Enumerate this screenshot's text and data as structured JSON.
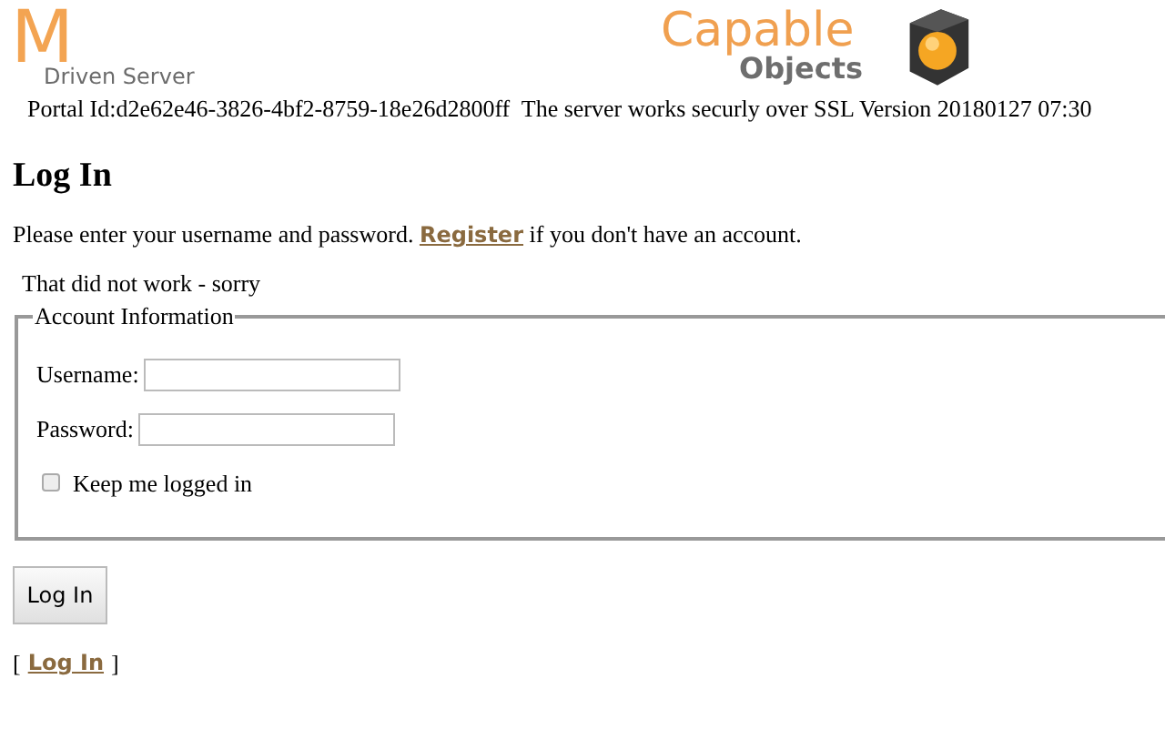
{
  "header": {
    "logo_letter": "M",
    "logo_subtitle": "Driven Server",
    "brand_top": "Capable",
    "brand_bottom": "Objects",
    "status": "Portal Id:d2e62e46-3826-4bf2-8759-18e26d2800ff  The server works securly over SSL Version 20180127 07:30"
  },
  "heading": "Log In",
  "intro": {
    "before": "Please enter your username and password.",
    "link": "Register",
    "after": "if you don't have an account."
  },
  "error": "That did not work - sorry",
  "fieldset": {
    "legend": "Account Information",
    "fields": [
      {
        "label": "Username:"
      },
      {
        "label": "Password:"
      }
    ],
    "remember": {
      "label": "Keep me logged in",
      "checked": false
    }
  },
  "submit": "Log In",
  "footer": {
    "open": "[",
    "link": "Log In",
    "close": "]"
  }
}
